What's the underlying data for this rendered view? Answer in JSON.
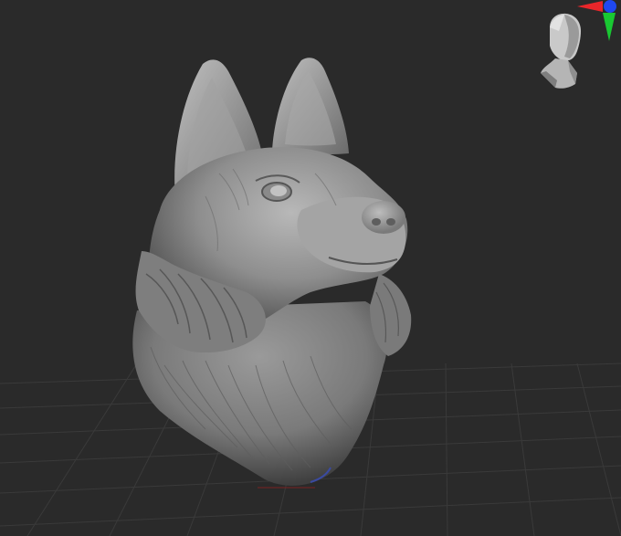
{
  "app": {
    "view_label": ""
  },
  "gizmo": {
    "axis_colors": {
      "x": "#e8262a",
      "y": "#19c832",
      "z": "#1f48f0"
    },
    "head_icon": "head-icon"
  },
  "scene": {
    "background": "#2a2a2a",
    "floor_grid_color": "#3a3a3a",
    "model_color": "#8d8d8d",
    "model_name": ""
  }
}
